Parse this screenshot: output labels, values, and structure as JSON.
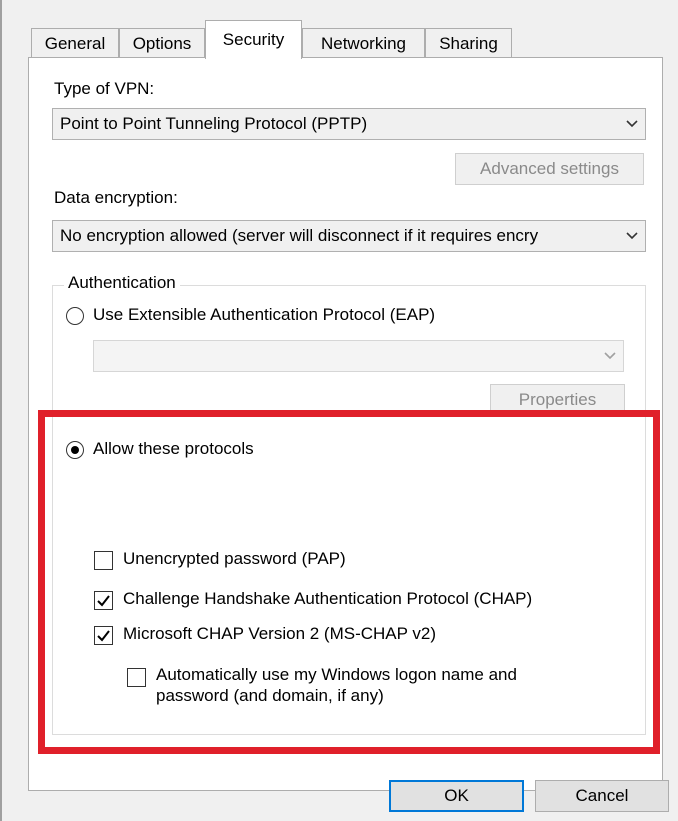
{
  "tabs": [
    {
      "label": "General",
      "active": false
    },
    {
      "label": "Options",
      "active": false
    },
    {
      "label": "Security",
      "active": true
    },
    {
      "label": "Networking",
      "active": false
    },
    {
      "label": "Sharing",
      "active": false
    }
  ],
  "vpn_type": {
    "label": "Type of VPN:",
    "selected": "Point to Point Tunneling Protocol (PPTP)"
  },
  "advanced_settings_label": "Advanced settings",
  "data_encryption": {
    "label": "Data encryption:",
    "selected": "No encryption allowed (server will disconnect if it requires encry"
  },
  "authentication": {
    "legend": "Authentication",
    "eap_radio_label": "Use Extensible Authentication Protocol (EAP)",
    "eap_radio_checked": false,
    "eap_combo_value": "",
    "properties_label": "Properties",
    "allow_radio_label": "Allow these protocols",
    "allow_radio_checked": true,
    "protocols": [
      {
        "label": "Unencrypted password (PAP)",
        "checked": false
      },
      {
        "label": "Challenge Handshake Authentication Protocol (CHAP)",
        "checked": true
      },
      {
        "label": "Microsoft CHAP Version 2 (MS-CHAP v2)",
        "checked": true
      }
    ],
    "auto_logon_line1": "Automatically use my Windows logon name and",
    "auto_logon_line2": "password (and domain, if any)",
    "auto_logon_checked": false
  },
  "footer": {
    "ok_label": "OK",
    "cancel_label": "Cancel"
  },
  "colors": {
    "highlight": "#e0202a",
    "background": "#f0f0f0"
  }
}
